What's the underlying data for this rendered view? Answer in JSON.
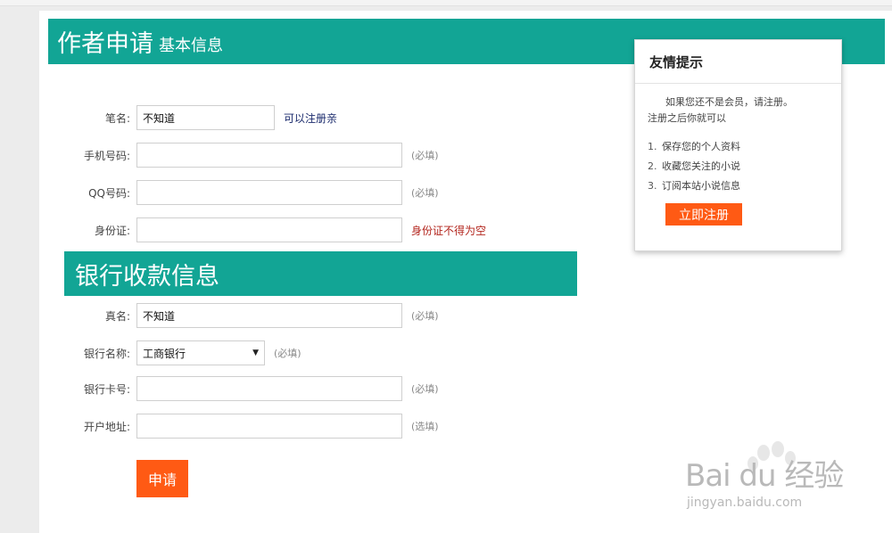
{
  "author_section": {
    "title": "作者申请",
    "subtitle": "基本信息"
  },
  "fields": {
    "penname": {
      "label": "笔名:",
      "value": "不知道",
      "hint": "可以注册亲"
    },
    "phone": {
      "label": "手机号码:",
      "value": "",
      "hint": "(必填)"
    },
    "qq": {
      "label": "QQ号码:",
      "value": "",
      "hint": "(必填)"
    },
    "idcard": {
      "label": "身份证:",
      "value": "",
      "error": "身份证不得为空"
    }
  },
  "bank_section": {
    "title": "银行收款信息"
  },
  "bank_fields": {
    "realname": {
      "label": "真名:",
      "value": "不知道",
      "hint": "(必填)"
    },
    "bankname": {
      "label": "银行名称:",
      "selected": "工商银行",
      "hint": "(必填)"
    },
    "cardno": {
      "label": "银行卡号:",
      "value": "",
      "hint": "(必填)"
    },
    "address": {
      "label": "开户地址:",
      "value": "",
      "hint": "(选填)"
    }
  },
  "submit_label": "申请",
  "tip": {
    "title": "友情提示",
    "intro1": "如果您还不是会员，请注册。",
    "intro2": "注册之后你就可以",
    "items": [
      {
        "num": "1.",
        "text": "保存您的个人资料"
      },
      {
        "num": "2.",
        "text": "收藏您关注的小说"
      },
      {
        "num": "3.",
        "text": "订阅本站小说信息"
      }
    ],
    "button": "立即注册"
  },
  "watermark": {
    "text": "Bai du 经验",
    "sub": "jingyan.baidu.com"
  },
  "colors": {
    "teal": "#12a595",
    "orange": "#ff5a14",
    "error": "#b3261e"
  }
}
